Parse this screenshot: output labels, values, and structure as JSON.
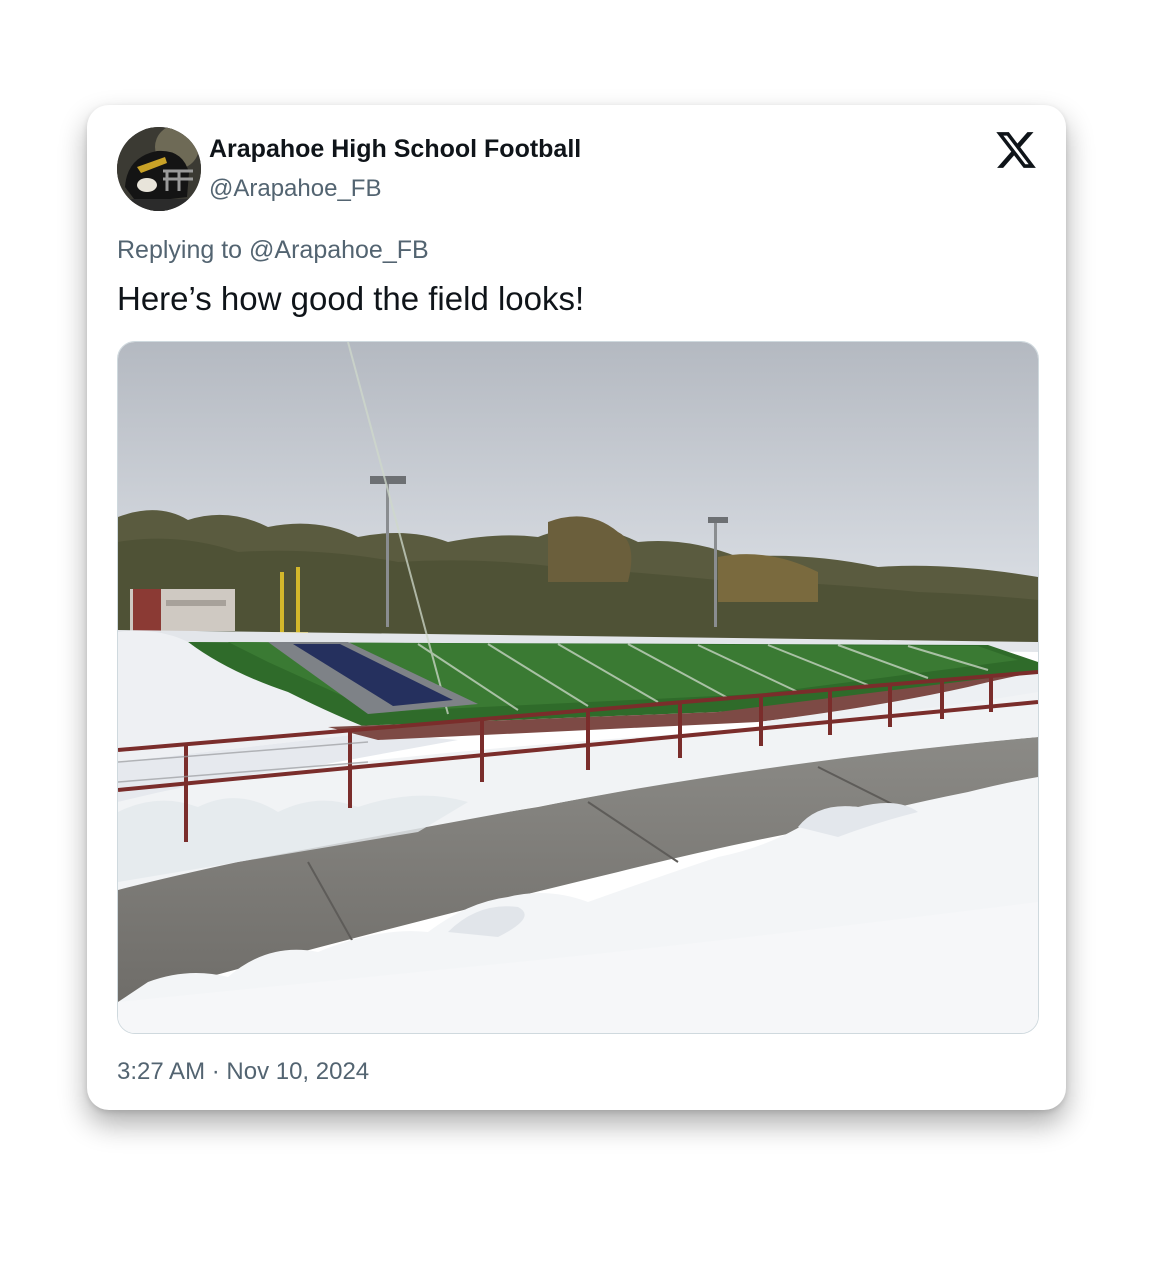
{
  "tweet": {
    "author_name": "Arapahoe High School Football",
    "author_handle": "@Arapahoe_FB",
    "reply_prefix": "Replying to",
    "reply_handle": "@Arapahoe_FB",
    "text": "Here’s how good the field looks!",
    "timestamp": "3:27 AM · Nov 10, 2024"
  },
  "icons": {
    "platform_logo": "x-logo-icon",
    "avatar": "football-helmet-avatar"
  },
  "colors": {
    "text_primary": "#0f1419",
    "text_secondary": "#536471",
    "card_background": "#ffffff"
  }
}
